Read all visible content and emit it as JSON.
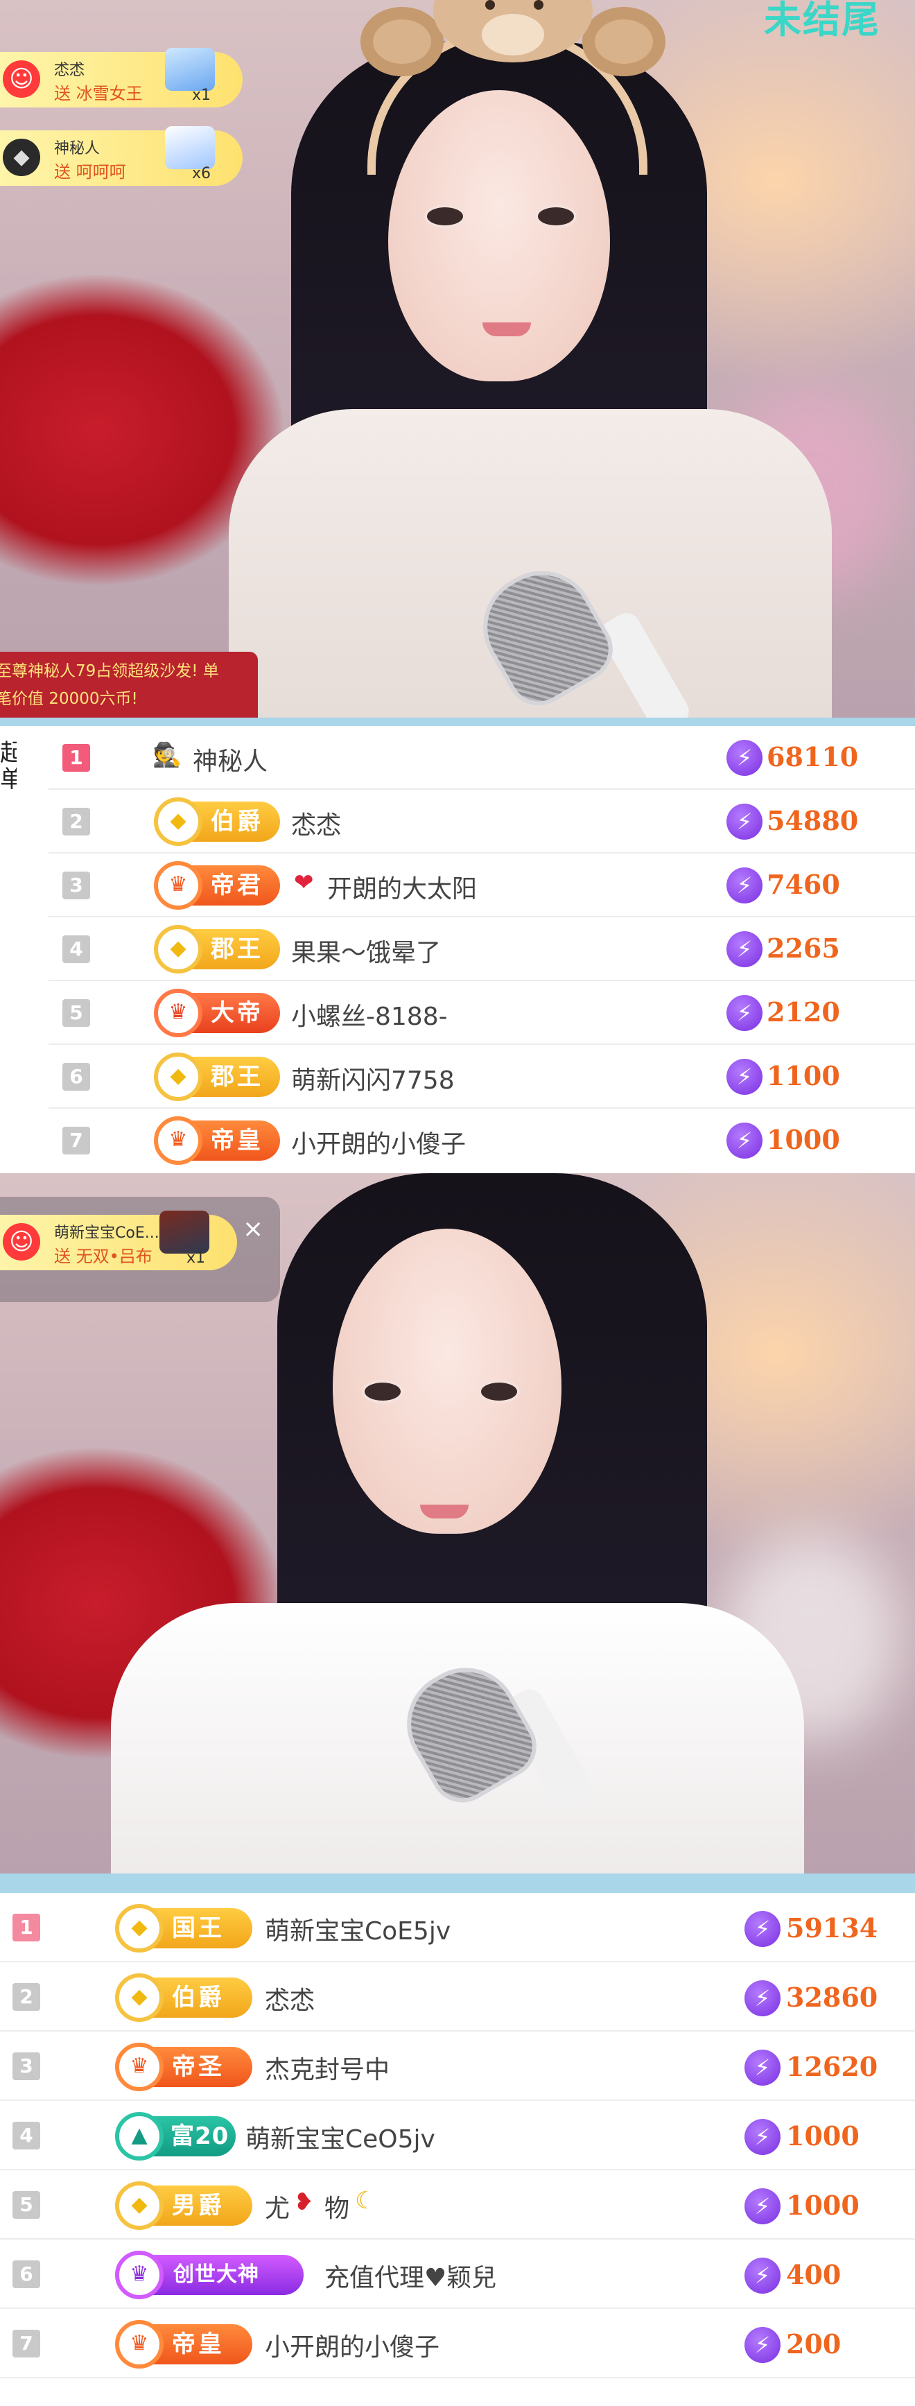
{
  "watermark": "未结尾",
  "stream_top": {
    "gifts": [
      {
        "user": "怸怸",
        "message": "送 冰雪女王",
        "count": "x1"
      },
      {
        "user": "神秘人",
        "message": "送 呵呵呵",
        "count": "x6"
      }
    ],
    "system_message": {
      "line1": "至尊神秘人79占领超级沙发! 单",
      "line2": "笔价值 20000六币!"
    }
  },
  "rank_list_1": {
    "side_label": "起单",
    "rows": [
      {
        "rank": "1",
        "badge": "",
        "name": "神秘人",
        "score": "68110"
      },
      {
        "rank": "2",
        "badge": "伯爵",
        "name": "怸怸",
        "score": "54880"
      },
      {
        "rank": "3",
        "badge": "帝君",
        "name": "开朗的大太阳",
        "score": "7460"
      },
      {
        "rank": "4",
        "badge": "郡王",
        "name": "果果～饿晕了",
        "score": "2265"
      },
      {
        "rank": "5",
        "badge": "大帝",
        "name": "小螺丝-8188-",
        "score": "2120"
      },
      {
        "rank": "6",
        "badge": "郡王",
        "name": "萌新闪闪7758",
        "score": "1100"
      },
      {
        "rank": "7",
        "badge": "帝皇",
        "name": "小开朗的小傻子",
        "score": "1000"
      }
    ]
  },
  "stream_bottom": {
    "gift": {
      "user": "萌新宝宝CoE...",
      "message": "送 无双•吕布",
      "count": "x1"
    }
  },
  "rank_list_2": {
    "rows": [
      {
        "rank": "1",
        "badge": "国王",
        "name": "萌新宝宝CoE5jv",
        "score": "59134"
      },
      {
        "rank": "2",
        "badge": "伯爵",
        "name": "怸怸",
        "score": "32860"
      },
      {
        "rank": "3",
        "badge": "帝圣",
        "name": "杰克封号中",
        "score": "12620"
      },
      {
        "rank": "4",
        "badge": "富20",
        "name": "萌新宝宝CeO5jv",
        "score": "1000"
      },
      {
        "rank": "5",
        "badge": "男爵",
        "name": "尤",
        "name_suffix": "物",
        "score": "1000"
      },
      {
        "rank": "6",
        "badge": "创世大神",
        "name": "充值代理♥颖兒",
        "score": "400"
      },
      {
        "rank": "7",
        "badge": "帝皇",
        "name": "小开朗的小傻子",
        "score": "200"
      }
    ]
  },
  "colors": {
    "accent_blue": "#a9d6e8",
    "score_orange": "#f0651d",
    "rank_first": "#f25c7a",
    "bolt_purple": "#7a2fe0"
  }
}
